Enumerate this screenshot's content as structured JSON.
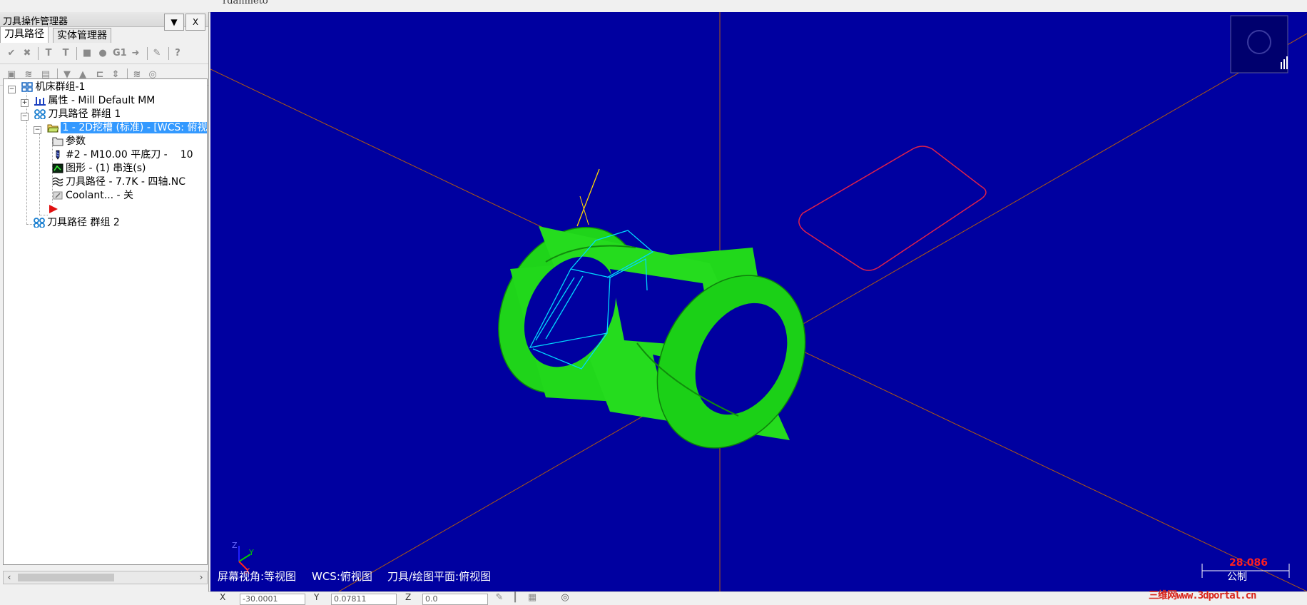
{
  "window": {
    "title_fragment": "rdanmeto"
  },
  "panel": {
    "title": "刀具操作管理器",
    "dropdown_label": "▼",
    "close_label": "X",
    "tabs": [
      "刀具路径",
      "实体管理器"
    ]
  },
  "tree": {
    "root": "机床群组-1",
    "properties": "属性 - Mill Default MM",
    "group1": "刀具路径 群组 1",
    "operation": "1 - 2D挖槽 (标准) - [WCS: 俯视",
    "params": "参数",
    "tool": "#2 - M10.00 平底刀 -",
    "tool_num": "10",
    "geometry": "图形 - (1) 串连(s)",
    "toolpath": "刀具路径 - 7.7K - 四轴.NC",
    "coolant": "Coolant... - 关",
    "group2": "刀具路径 群组 2"
  },
  "viewport": {
    "bg_color": "#0000a0",
    "status_view": "屏幕视角:等视图",
    "status_wcs": "WCS:俯视图",
    "status_plane": "刀具/绘图平面:俯视图",
    "scale_value": "28.086",
    "scale_unit": "公制",
    "axis_x": "X",
    "axis_y": "Y",
    "axis_z": "Z"
  },
  "statusbar": {
    "x_label": "X",
    "x_value": "-30.0001",
    "y_label": "Y",
    "y_value": "0.07811",
    "z_label": "Z",
    "z_value": "0.0"
  },
  "watermark": "三维网www.3dportal.cn",
  "colors": {
    "part": "#2ee01a",
    "toolpath": "#00d8ff",
    "selection": "#3399ff",
    "axis_lines": "#b05a10",
    "boundary": "#e0204a"
  }
}
